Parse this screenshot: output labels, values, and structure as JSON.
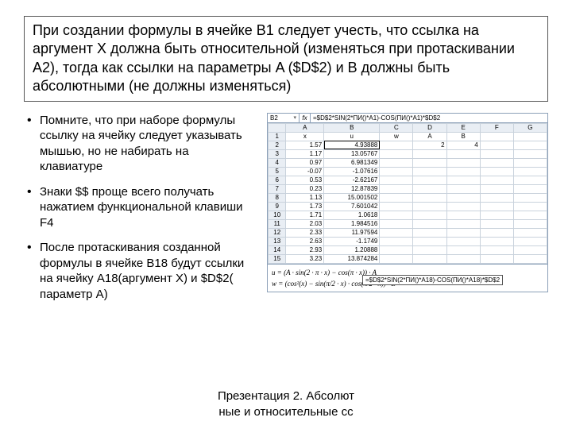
{
  "title": "При создании формулы в ячейке B1  следует учесть, что ссылка на аргумент X должна быть относительной (изменяться при протаскивании  A2), тогда как ссылки на параметры A ($D$2) и B должны быть абсолютными (не должны изменяться)",
  "bullets": [
    "Помните, что при наборе формулы ссылку на ячейку следует указывать мышью, но не набирать на клавиатуре",
    "Знаки $$ проще всего получать нажатием функциональной клавиши F4",
    "После протаскивания созданной формулы в ячейке B18 будут ссылки на ячейку A18(аргумент X) и $D$2( параметр A)"
  ],
  "sheet": {
    "namebox": "B2",
    "fx": "fx",
    "formula_bar": "=$D$2*SIN(2*ПИ()*A1)-COS(ПИ()*A1)*$D$2",
    "col_headers": [
      "A",
      "B",
      "C",
      "D",
      "E",
      "F",
      "G"
    ],
    "header_row": [
      "x",
      "u",
      "w",
      "A",
      "B",
      "",
      ""
    ],
    "rows": [
      [
        "1.57",
        "4.93888",
        "",
        "2",
        "4",
        "",
        ""
      ],
      [
        "1.17",
        "13.05767",
        "",
        "",
        "",
        "",
        ""
      ],
      [
        "0.97",
        "6.981349",
        "",
        "",
        "",
        "",
        ""
      ],
      [
        "-0.07",
        "-1.07616",
        "",
        "",
        "",
        "",
        ""
      ],
      [
        "0.53",
        "-2.62167",
        "",
        "",
        "",
        "",
        ""
      ],
      [
        "0.23",
        "12.87839",
        "",
        "",
        "",
        "",
        ""
      ],
      [
        "1.13",
        "15.001502",
        "",
        "",
        "",
        "",
        ""
      ],
      [
        "1.73",
        "7.601042",
        "",
        "",
        "",
        "",
        ""
      ],
      [
        "1.71",
        "1.0618",
        "",
        "",
        "",
        "",
        ""
      ],
      [
        "2.03",
        "1.984516",
        "",
        "",
        "",
        "",
        ""
      ],
      [
        "2.33",
        "11.97594",
        "",
        "",
        "",
        "",
        ""
      ],
      [
        "2.63",
        "-1.1749",
        "",
        "",
        "",
        "",
        ""
      ],
      [
        "2.93",
        "1.20888",
        "",
        "",
        "",
        "",
        ""
      ],
      [
        "3.23",
        "13.874284",
        "",
        "",
        "",
        "",
        ""
      ]
    ],
    "tooltip": "=$D$2*SIN(2*ПИ()*A18)-COS(ПИ()*A18)*$D$2",
    "eq1": "u = (A · sin(2 · π · x) − cos(π · x)) · A",
    "eq2": "w = (cos²(x) − sin(π/2 · x) · cos(π/2 · x)) · B"
  },
  "footer_line1": "Презентация 2. Абсолют",
  "footer_line2": "ные и относительные сс"
}
